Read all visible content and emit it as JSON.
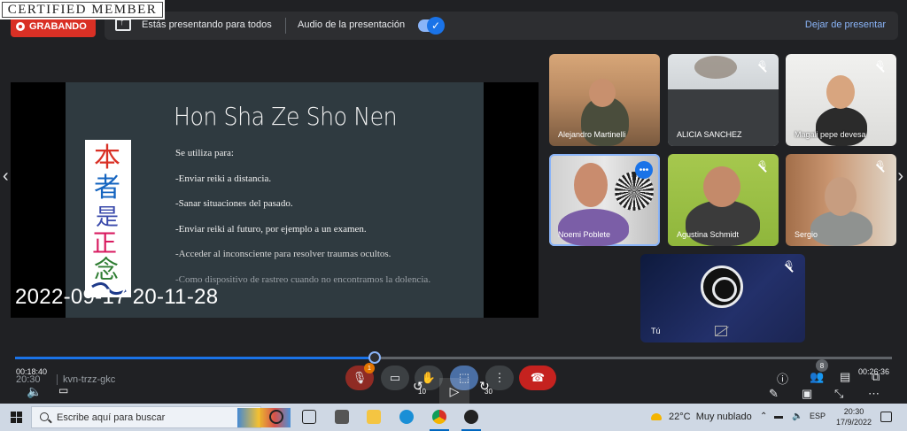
{
  "stamp": "CERTIFIED MEMBER",
  "topbar": {
    "recording_label": "GRABANDO",
    "presenting_text": "Estás presentando para todos",
    "audio_label": "Audio de la presentación",
    "stop_presenting": "Dejar de presentar",
    "audio_on": true
  },
  "slide": {
    "title": "Hon Sha Ze Sho Nen",
    "lines": [
      "Se utiliza para:",
      "-Enviar reiki a distancia.",
      "-Sanar situaciones del pasado.",
      "-Enviar reiki al futuro, por ejemplo a un examen.",
      "-Acceder al inconsciente para resolver traumas ocultos.",
      "-Como dispositivo de rastreo cuando no encontramos la dolencia."
    ]
  },
  "overlay_timestamp": "2022-09-17 20-11-28",
  "participants": [
    {
      "name": "Alejandro Martinelli",
      "muted": false
    },
    {
      "name": "ALICIA SANCHEZ",
      "muted": true
    },
    {
      "name": "Magali pepe devesa",
      "muted": true
    },
    {
      "name": "Noemi Poblete",
      "muted": false
    },
    {
      "name": "Agustina Schmidt",
      "muted": true
    },
    {
      "name": "Sergio",
      "muted": true
    }
  ],
  "self": {
    "name": "Tú"
  },
  "player": {
    "elapsed": "00:18:40",
    "total": "00:26:36",
    "progress": 0.41,
    "skip_back": "10",
    "skip_forward": "30"
  },
  "meeting": {
    "clock": "20:30",
    "code": "kvn-trzz-gkc",
    "mic_badge": "1",
    "people_count": "8"
  },
  "taskbar": {
    "search_placeholder": "Escribe aquí para buscar",
    "temperature": "22°C",
    "weather": "Muy nublado",
    "language": "ESP",
    "time": "20:30",
    "date": "17/9/2022"
  }
}
